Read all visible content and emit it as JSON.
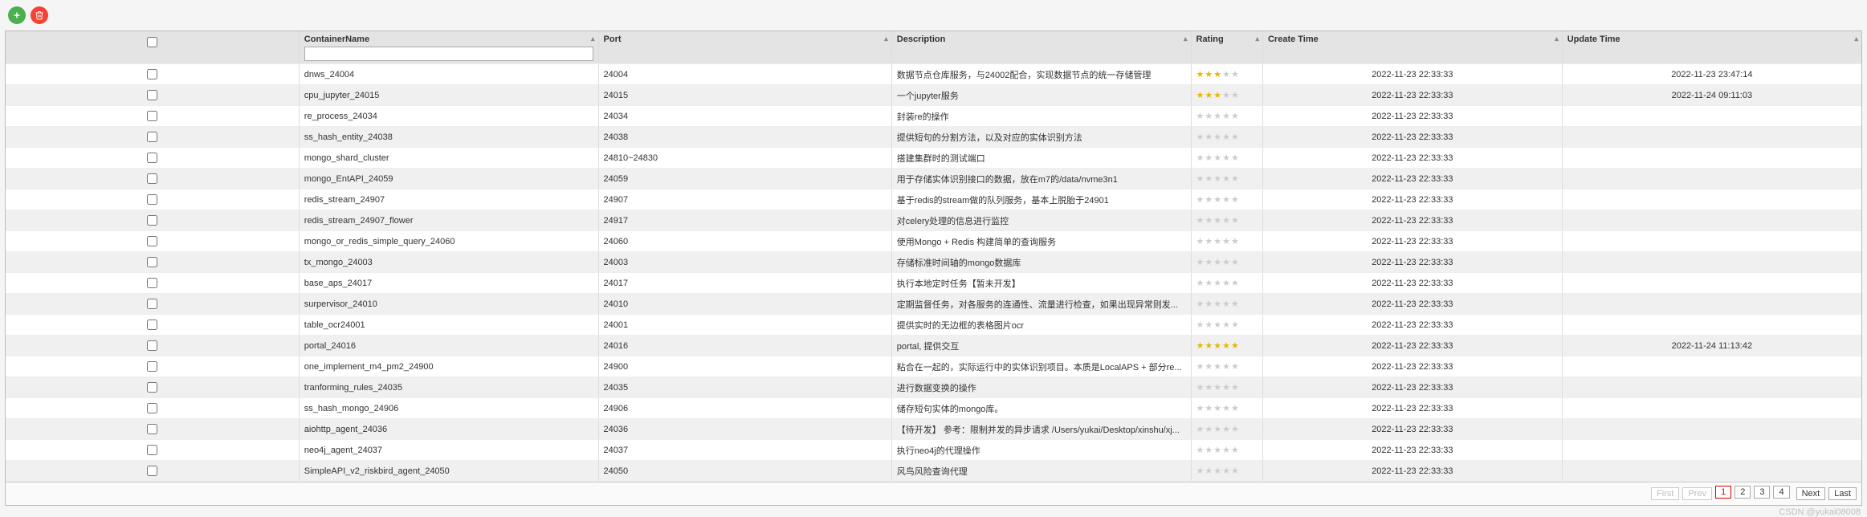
{
  "toolbar": {
    "add_icon": "plus-icon",
    "delete_icon": "trash-icon"
  },
  "columns": {
    "check": "",
    "name": "ContainerName",
    "port": "Port",
    "desc": "Description",
    "rating": "Rating",
    "ctime": "Create Time",
    "utime": "Update Time"
  },
  "filter": {
    "name_value": ""
  },
  "rows": [
    {
      "name": "dnws_24004",
      "port": "24004",
      "desc": "数据节点仓库服务，与24002配合，实现数据节点的统一存储管理",
      "rating": 3,
      "ctime": "2022-11-23 22:33:33",
      "utime": "2022-11-23 23:47:14"
    },
    {
      "name": "cpu_jupyter_24015",
      "port": "24015",
      "desc": "一个jupyter服务",
      "rating": 3,
      "ctime": "2022-11-23 22:33:33",
      "utime": "2022-11-24 09:11:03"
    },
    {
      "name": "re_process_24034",
      "port": "24034",
      "desc": "封装re的操作",
      "rating": 0,
      "ctime": "2022-11-23 22:33:33",
      "utime": ""
    },
    {
      "name": "ss_hash_entity_24038",
      "port": "24038",
      "desc": "提供短句的分割方法，以及对应的实体识别方法",
      "rating": 0,
      "ctime": "2022-11-23 22:33:33",
      "utime": ""
    },
    {
      "name": "mongo_shard_cluster",
      "port": "24810~24830",
      "desc": "搭建集群时的测试端口",
      "rating": 0,
      "ctime": "2022-11-23 22:33:33",
      "utime": ""
    },
    {
      "name": "mongo_EntAPI_24059",
      "port": "24059",
      "desc": "用于存储实体识别接口的数据，放在m7的/data/nvme3n1",
      "rating": 0,
      "ctime": "2022-11-23 22:33:33",
      "utime": ""
    },
    {
      "name": "redis_stream_24907",
      "port": "24907",
      "desc": "基于redis的stream做的队列服务，基本上脱胎于24901",
      "rating": 0,
      "ctime": "2022-11-23 22:33:33",
      "utime": ""
    },
    {
      "name": "redis_stream_24907_flower",
      "port": "24917",
      "desc": "对celery处理的信息进行监控",
      "rating": 0,
      "ctime": "2022-11-23 22:33:33",
      "utime": ""
    },
    {
      "name": "mongo_or_redis_simple_query_24060",
      "port": "24060",
      "desc": "使用Mongo + Redis 构建简单的查询服务",
      "rating": 0,
      "ctime": "2022-11-23 22:33:33",
      "utime": ""
    },
    {
      "name": "tx_mongo_24003",
      "port": "24003",
      "desc": "存储标准时间轴的mongo数据库",
      "rating": 0,
      "ctime": "2022-11-23 22:33:33",
      "utime": ""
    },
    {
      "name": "base_aps_24017",
      "port": "24017",
      "desc": "执行本地定时任务【暂未开发】",
      "rating": 0,
      "ctime": "2022-11-23 22:33:33",
      "utime": ""
    },
    {
      "name": "surpervisor_24010",
      "port": "24010",
      "desc": "定期监督任务，对各服务的连通性、流量进行检查，如果出现异常则发...",
      "rating": 0,
      "ctime": "2022-11-23 22:33:33",
      "utime": ""
    },
    {
      "name": "table_ocr24001",
      "port": "24001",
      "desc": "提供实时的无边框的表格图片ocr",
      "rating": 0,
      "ctime": "2022-11-23 22:33:33",
      "utime": ""
    },
    {
      "name": "portal_24016",
      "port": "24016",
      "desc": "portal, 提供交互",
      "rating": 5,
      "ctime": "2022-11-23 22:33:33",
      "utime": "2022-11-24 11:13:42"
    },
    {
      "name": "one_implement_m4_pm2_24900",
      "port": "24900",
      "desc": "粘合在一起的，实际运行中的实体识别项目。本质是LocalAPS + 部分re...",
      "rating": 0,
      "ctime": "2022-11-23 22:33:33",
      "utime": ""
    },
    {
      "name": "tranforming_rules_24035",
      "port": "24035",
      "desc": "进行数据变换的操作",
      "rating": 0,
      "ctime": "2022-11-23 22:33:33",
      "utime": ""
    },
    {
      "name": "ss_hash_mongo_24906",
      "port": "24906",
      "desc": "储存短句实体的mongo库。",
      "rating": 0,
      "ctime": "2022-11-23 22:33:33",
      "utime": ""
    },
    {
      "name": "aiohttp_agent_24036",
      "port": "24036",
      "desc": "【待开发】 参考：限制并发的异步请求 /Users/yukai/Desktop/xinshu/xj...",
      "rating": 0,
      "ctime": "2022-11-23 22:33:33",
      "utime": ""
    },
    {
      "name": "neo4j_agent_24037",
      "port": "24037",
      "desc": "执行neo4j的代理操作",
      "rating": 0,
      "ctime": "2022-11-23 22:33:33",
      "utime": ""
    },
    {
      "name": "SimpleAPI_v2_riskbird_agent_24050",
      "port": "24050",
      "desc": "风鸟风险查询代理",
      "rating": 0,
      "ctime": "2022-11-23 22:33:33",
      "utime": ""
    }
  ],
  "pagination": {
    "first": "First",
    "prev": "Prev",
    "pages": [
      "1",
      "2",
      "3",
      "4"
    ],
    "current": "1",
    "next": "Next",
    "last": "Last"
  },
  "watermark": "CSDN @yukai08008"
}
